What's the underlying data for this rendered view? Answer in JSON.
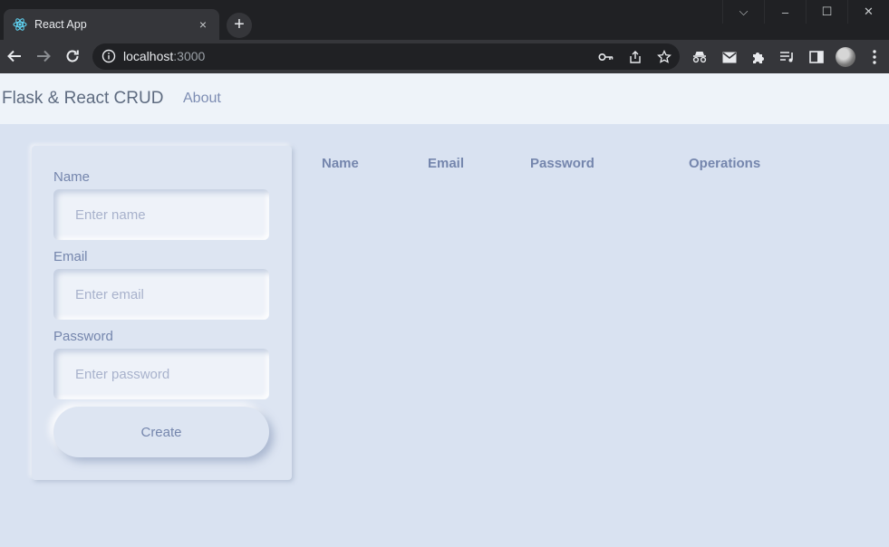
{
  "browser": {
    "tab_title": "React App",
    "tab_close": "×",
    "new_tab": "+",
    "url_host": "localhost",
    "url_port": ":3000",
    "window_controls": {
      "dropdown": "⌵",
      "minimize": "–",
      "maximize": "☐",
      "close": "✕"
    }
  },
  "navbar": {
    "brand": "Flask & React CRUD",
    "about": "About"
  },
  "form": {
    "name_label": "Name",
    "name_placeholder": "Enter name",
    "email_label": "Email",
    "email_placeholder": "Enter email",
    "password_label": "Password",
    "password_placeholder": "Enter password",
    "create_label": "Create"
  },
  "table": {
    "headers": [
      "Name",
      "Email",
      "Password",
      "Operations"
    ]
  },
  "colors": {
    "page_bg": "#d9e2f1",
    "navbar_bg": "#eef3f9",
    "text_accent": "#7586ad"
  }
}
